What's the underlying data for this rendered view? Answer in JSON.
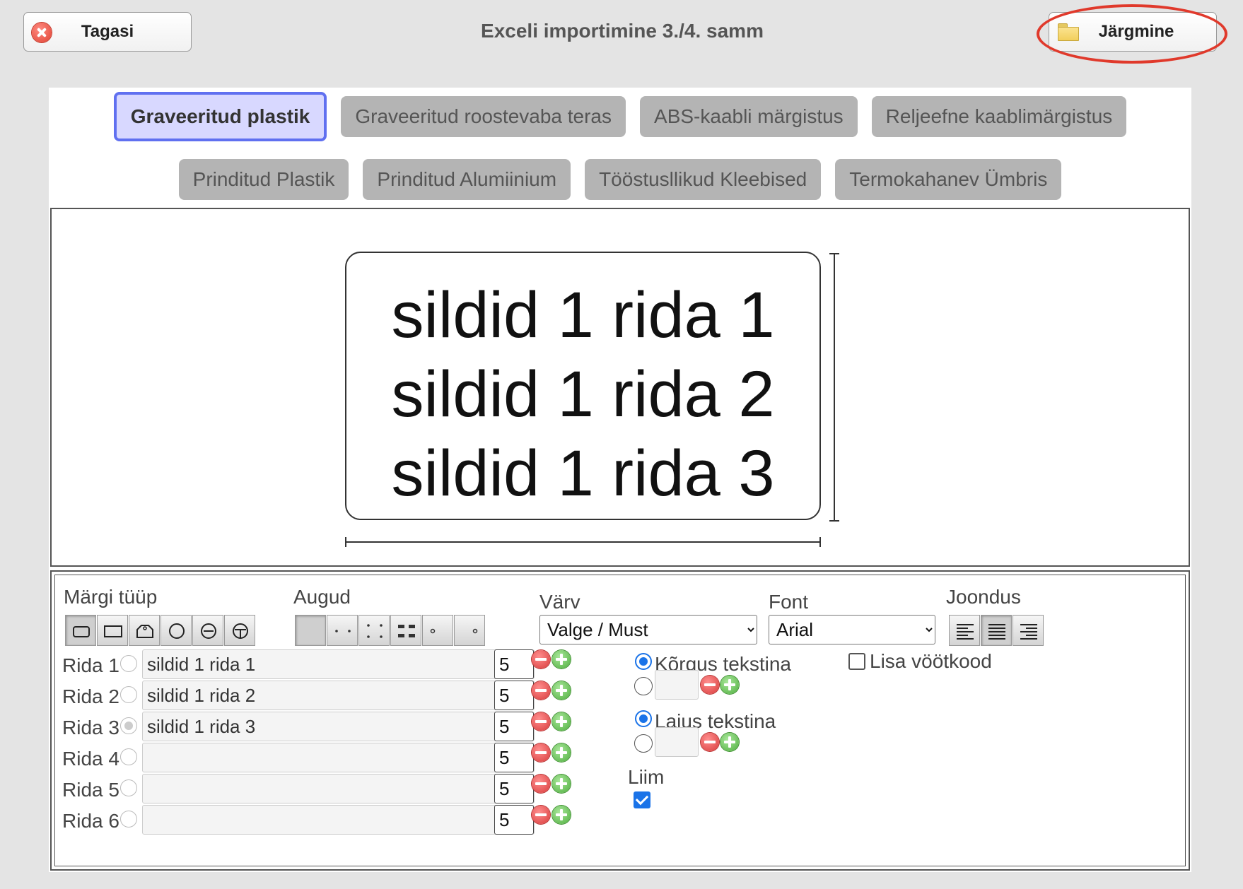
{
  "header": {
    "back_label": "Tagasi",
    "title": "Exceli importimine 3./4. samm",
    "next_label": "Järgmine"
  },
  "materials": {
    "row1": [
      "Graveeritud plastik",
      "Graveeritud roostevaba teras",
      "ABS-kaabli märgistus",
      "Reljeefne kaablimärgistus"
    ],
    "row2": [
      "Prinditud Plastik",
      "Prinditud Alumiinium",
      "Tööstusllikud Kleebised",
      "Termokahanev Ümbris"
    ],
    "active": "Graveeritud plastik"
  },
  "preview": {
    "lines": [
      "sildid 1 rida 1",
      "sildid 1 rida 2",
      "sildid 1 rida 3"
    ]
  },
  "controls": {
    "sign_type_label": "Märgi tüüp",
    "holes_label": "Augud",
    "color_label": "Värv",
    "color_value": "Valge / Must",
    "font_label": "Font",
    "font_value": "Arial",
    "align_label": "Joondus",
    "rows": [
      {
        "label": "Rida 1",
        "text": "sildid 1 rida 1",
        "size": "5"
      },
      {
        "label": "Rida 2",
        "text": "sildid 1 rida 2",
        "size": "5"
      },
      {
        "label": "Rida 3",
        "text": "sildid 1 rida 3",
        "size": "5"
      },
      {
        "label": "Rida 4",
        "text": "",
        "size": "5"
      },
      {
        "label": "Rida 5",
        "text": "",
        "size": "5"
      },
      {
        "label": "Rida 6",
        "text": "",
        "size": "5"
      }
    ],
    "height_text_label": "Kõrgus tekstina",
    "width_text_label": "Laius tekstina",
    "glue_label": "Liim",
    "glue_checked": true,
    "barcode_label": "Lisa vöötkood",
    "barcode_checked": false
  },
  "colors": {
    "accent": "#6070f0",
    "active_tab_bg": "#d8d8ff",
    "tab_bg": "#b4b4b4",
    "highlight": "#e0392b",
    "checkbox": "#1a73e8"
  }
}
